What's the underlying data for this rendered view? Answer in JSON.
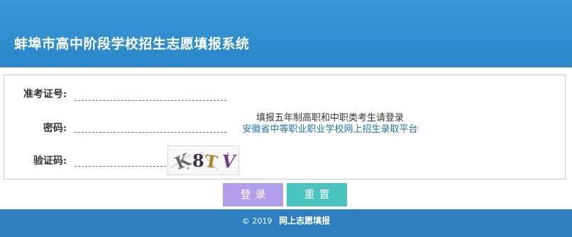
{
  "header": {
    "title": "蚌埠市高中阶段学校招生志愿填报系统"
  },
  "form": {
    "candidate_id_label": "准考证号:",
    "candidate_id_value": "",
    "password_label": "密码:",
    "password_value": "",
    "captcha_label": "验证码:",
    "captcha_value": "",
    "captcha_image_text": "K8TV"
  },
  "notice": {
    "text": "填报五年制高职和中职类考生请登录",
    "link": "安徽省中等职业职业学校网上招生录取平台"
  },
  "buttons": {
    "login": "登录",
    "reset": "重置"
  },
  "footer": {
    "copyright": "© 2019",
    "label": "网上志愿填报"
  },
  "colors": {
    "header_bg": "#2f8fd0",
    "login_btn": "#b19de9",
    "reset_btn": "#48c3bd",
    "footer_bg": "#2e7fc0",
    "link": "#1e6fb6"
  }
}
